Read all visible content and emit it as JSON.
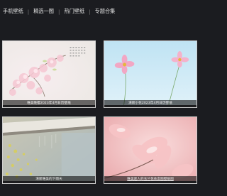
{
  "nav": {
    "items": [
      "手机壁纸",
      "精选一图",
      "热门壁纸",
      "专题合集"
    ]
  },
  "cards": [
    {
      "caption": "唯美晚樱2023年4月日历壁纸"
    },
    {
      "caption": "清新小花2023年4月日历壁纸"
    },
    {
      "caption": "清新唯美的下雨天"
    },
    {
      "caption": "唯美迷人的玉兰花朵友图壁纸图"
    }
  ],
  "colors": {
    "background": "#1b1c20",
    "caption_bar": "#141414",
    "card_border": "#cfcfcf"
  }
}
